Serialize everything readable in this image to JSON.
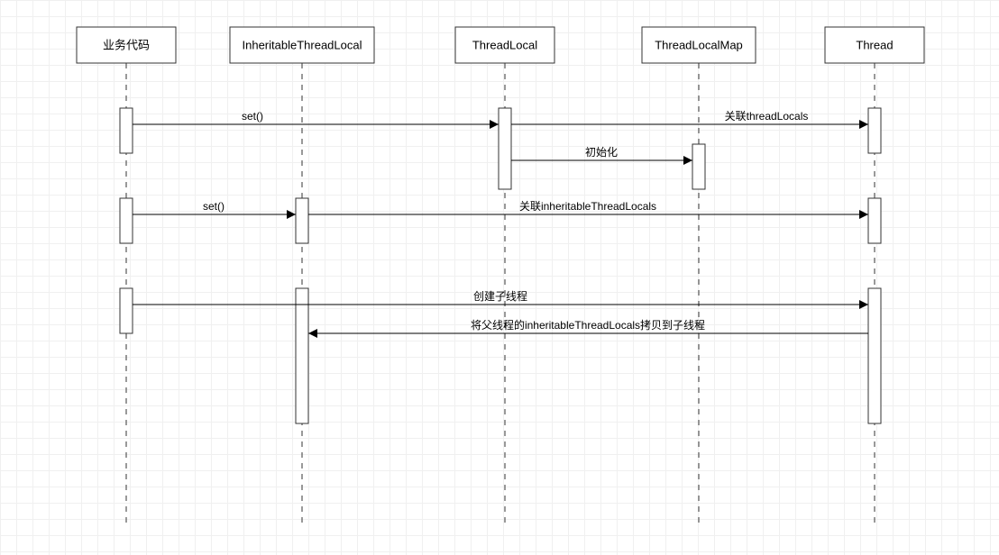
{
  "participants": {
    "p1": "业务代码",
    "p2": "InheritableThreadLocal",
    "p3": "ThreadLocal",
    "p4": "ThreadLocalMap",
    "p5": "Thread"
  },
  "messages": {
    "m1": "set()",
    "m2": "关联threadLocals",
    "m3": "初始化",
    "m4": "set()",
    "m5": "关联inheritableThreadLocals",
    "m6": "创建子线程",
    "m7": "将父线程的inheritableThreadLocals拷贝到子线程"
  }
}
